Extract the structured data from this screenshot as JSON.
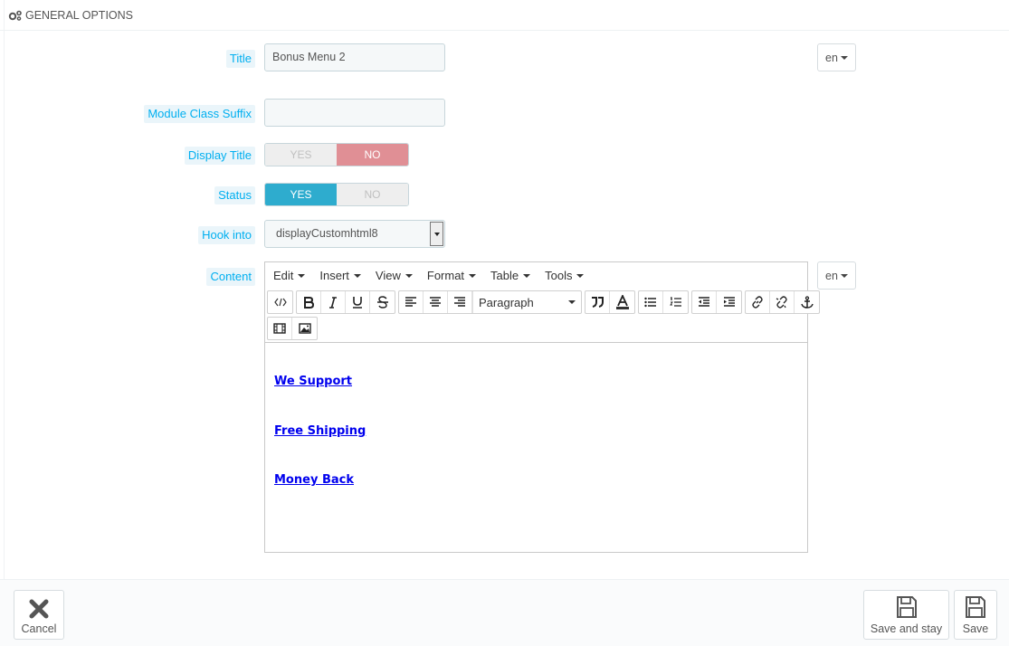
{
  "panel": {
    "title": "GENERAL OPTIONS",
    "icon": "cogs-icon"
  },
  "fields": {
    "title": {
      "label": "Title",
      "value": "Bonus Menu 2",
      "lang": "en"
    },
    "suffix": {
      "label": "Module Class Suffix",
      "value": ""
    },
    "display_title": {
      "label": "Display Title",
      "yes": "YES",
      "no": "NO",
      "selected": "NO"
    },
    "status": {
      "label": "Status",
      "yes": "YES",
      "no": "NO",
      "selected": "YES"
    },
    "hook": {
      "label": "Hook into",
      "value": "displayCustomhtml8"
    },
    "content": {
      "label": "Content",
      "lang": "en"
    }
  },
  "editor": {
    "menus": [
      "Edit",
      "Insert",
      "View",
      "Format",
      "Table",
      "Tools"
    ],
    "block_format": "Paragraph",
    "links": [
      "We Support",
      "Free Shipping",
      "Money Back"
    ]
  },
  "footer": {
    "cancel": "Cancel",
    "save_stay": "Save and stay",
    "save": "Save"
  },
  "colors": {
    "accent": "#00aff0",
    "yes_active": "#2eacce",
    "no_active": "#e08f95",
    "link": "#0000ee"
  }
}
